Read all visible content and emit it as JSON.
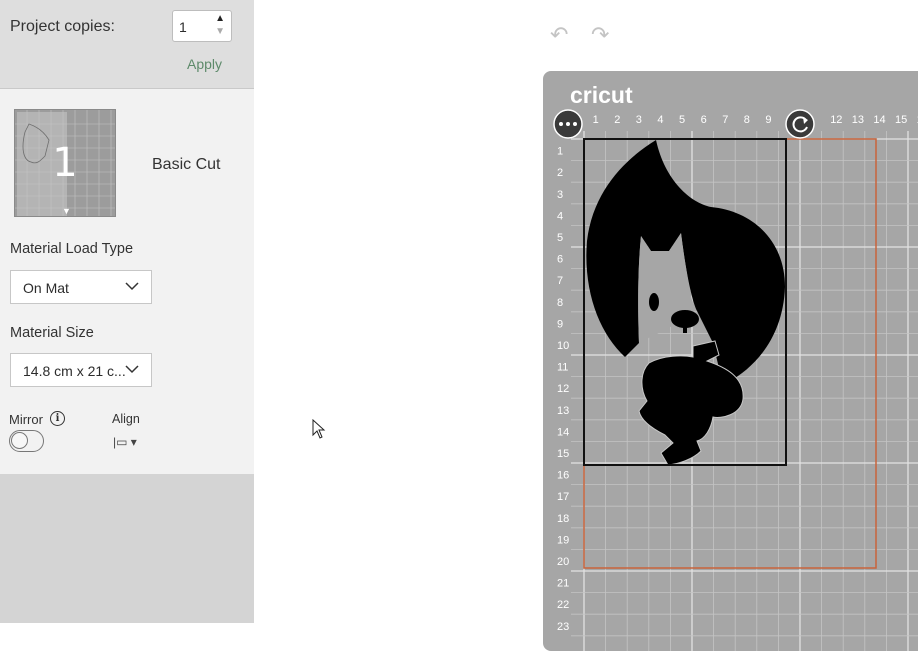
{
  "sidebar": {
    "project_copies_label": "Project copies:",
    "project_copies_value": "1",
    "apply_label": "Apply",
    "mat_number": "1",
    "mat_mode": "Basic Cut",
    "material_load_type_label": "Material Load Type",
    "material_load_type_value": "On Mat",
    "material_size_label": "Material Size",
    "material_size_value": "14.8 cm x 21 c...",
    "mirror_label": "Mirror",
    "mirror_on": false,
    "align_label": "Align"
  },
  "toolbar": {
    "undo_icon": "undo-icon",
    "redo_icon": "redo-icon"
  },
  "mat": {
    "brand": "cricut",
    "top_ruler": [
      "1",
      "2",
      "3",
      "4",
      "5",
      "6",
      "7",
      "8",
      "9",
      "1",
      "12",
      "13",
      "14",
      "15",
      "1"
    ],
    "left_ruler": [
      "1",
      "2",
      "3",
      "4",
      "5",
      "6",
      "7",
      "8",
      "9",
      "10",
      "11",
      "12",
      "13",
      "14",
      "15",
      "16",
      "17",
      "18",
      "19",
      "20",
      "21",
      "22",
      "23"
    ],
    "colors": {
      "mat": "#a6a6a6",
      "material_outline": "#c8643c",
      "design": "#000000"
    }
  },
  "colors": {
    "accent": "#5d8a6a",
    "panel": "#f2f2f2",
    "sidebar_bg": "#d4d4d4"
  }
}
